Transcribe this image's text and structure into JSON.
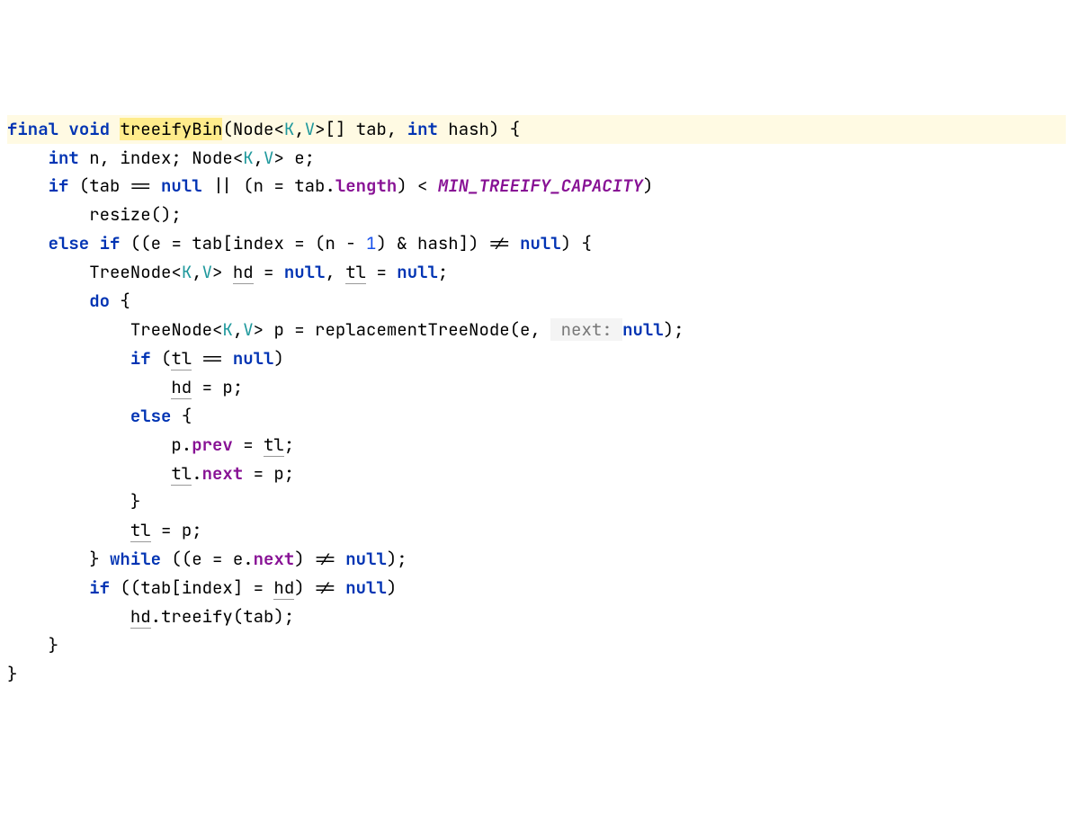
{
  "code": {
    "l1_final": "final",
    "l1_void": "void",
    "l1_name": "treeifyBin",
    "l1_node": "Node",
    "l1_k": "K",
    "l1_v": "V",
    "l1_rest": "[] tab, ",
    "l1_int": "int",
    "l1_hash": " hash) {",
    "l2_int": "int",
    "l2_vars": " n, index; ",
    "l2_node": "Node",
    "l2_k": "K",
    "l2_v": "V",
    "l2_e": " e;",
    "l3_if": "if",
    "l3_a": " (tab == ",
    "l3_null": "null",
    "l3_b": " || (n = tab.",
    "l3_len": "length",
    "l3_c": ") < ",
    "l3_const": "MIN_TREEIFY_CAPACITY",
    "l3_d": ")",
    "l4_resize": "resize();",
    "l5_else": "else",
    "l5_if": "if",
    "l5_a": " ((e = tab[index = (n - ",
    "l5_one": "1",
    "l5_b": ") & hash]) != ",
    "l5_null": "null",
    "l5_c": ") {",
    "l6_tn": "TreeNode",
    "l6_k": "K",
    "l6_v": "V",
    "l6_sp": " ",
    "l6_hd": "hd",
    "l6_a": " = ",
    "l6_null1": "null",
    "l6_b": ", ",
    "l6_tl": "tl",
    "l6_c": " = ",
    "l6_null2": "null",
    "l6_d": ";",
    "l7_do": "do",
    "l7_br": " {",
    "l8_tn": "TreeNode",
    "l8_k": "K",
    "l8_v": "V",
    "l8_a": " p = replacementTreeNode(e, ",
    "l8_hint": " next: ",
    "l8_null": "null",
    "l8_b": ");",
    "l9_if": "if",
    "l9_a": " (",
    "l9_tl": "tl",
    "l9_b": " == ",
    "l9_null": "null",
    "l9_c": ")",
    "l10_hd": "hd",
    "l10_a": " = p;",
    "l11_else": "else",
    "l11_br": " {",
    "l12_a": "p.",
    "l12_prev": "prev",
    "l12_b": " = ",
    "l12_tl": "tl",
    "l12_c": ";",
    "l13_tl": "tl",
    "l13_a": ".",
    "l13_next": "next",
    "l13_b": " = p;",
    "l14_br": "}",
    "l15_tl": "tl",
    "l15_a": " = p;",
    "l16_br": "} ",
    "l16_while": "while",
    "l16_a": " ((e = e.",
    "l16_next": "next",
    "l16_b": ") != ",
    "l16_null": "null",
    "l16_c": ");",
    "l17_if": "if",
    "l17_a": " ((tab[index] = ",
    "l17_hd": "hd",
    "l17_b": ") != ",
    "l17_null": "null",
    "l17_c": ")",
    "l18_hd": "hd",
    "l18_a": ".treeify(tab);",
    "l19_br": "}",
    "l20_br": "}"
  }
}
